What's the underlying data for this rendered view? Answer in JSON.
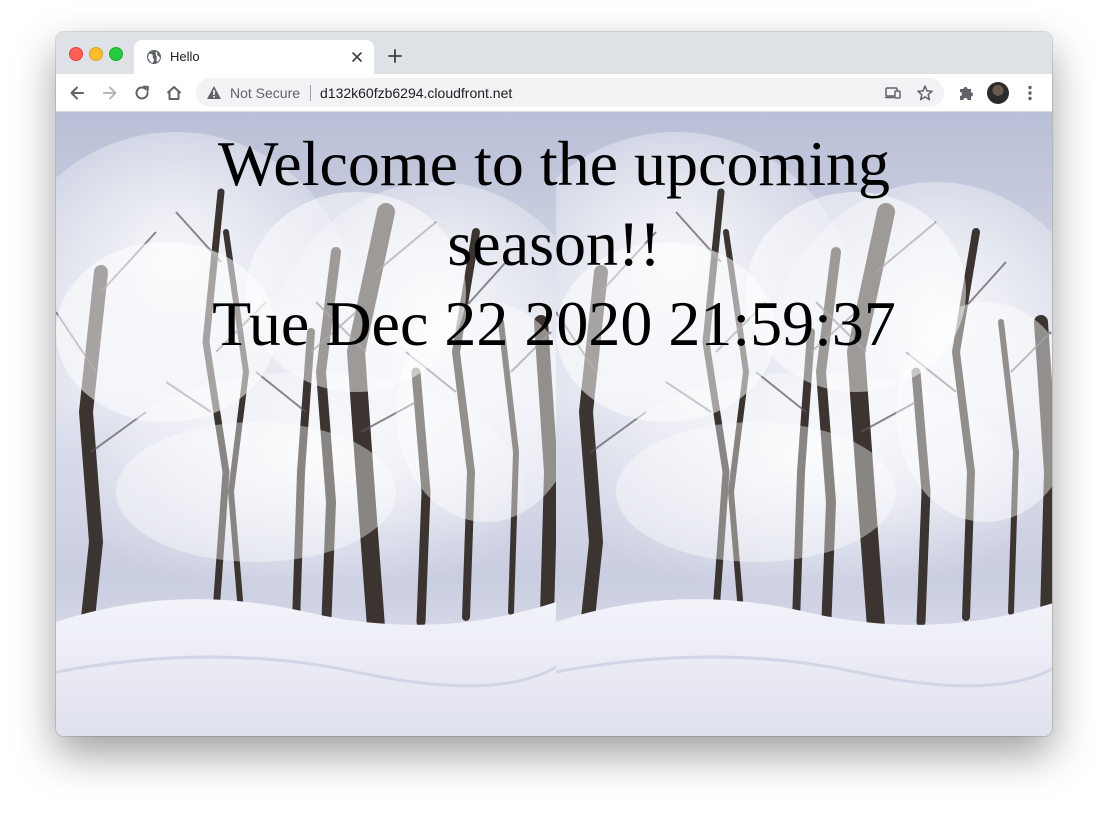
{
  "browser": {
    "tab": {
      "title": "Hello",
      "favicon": "globe-icon"
    },
    "address_bar": {
      "security_label": "Not Secure",
      "url": "d132k60fzb6294.cloudfront.net"
    }
  },
  "page": {
    "heading": "Welcome to the upcoming season!!",
    "datetime": "Tue Dec 22 2020 21:59:37"
  },
  "colors": {
    "tab_strip": "#dee1e6",
    "omnibox": "#f1f3f4",
    "text": "#000000"
  }
}
